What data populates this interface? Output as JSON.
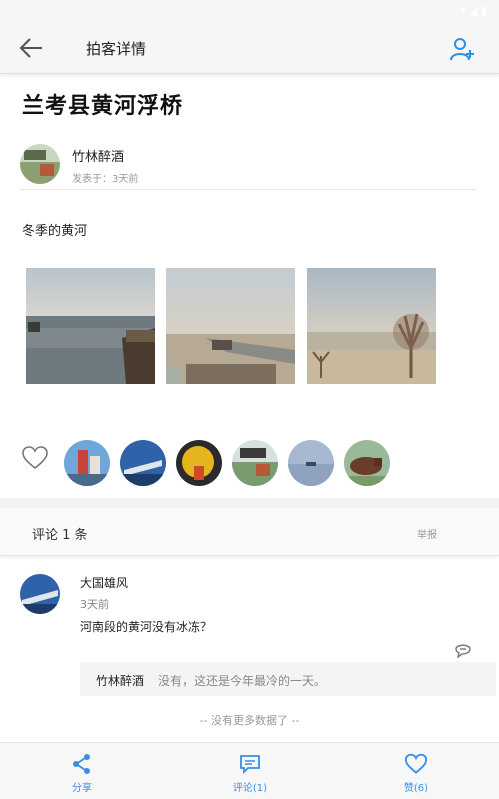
{
  "header": {
    "title": "拍客详情",
    "back_icon": "arrow-left-icon",
    "action_icon": "add-user-icon",
    "accent_color": "#2f8fe8"
  },
  "post": {
    "title": "兰考县黄河浮桥",
    "author": {
      "name": "竹林醉酒",
      "time": "发表于：3天前"
    },
    "text": "冬季的黄河",
    "photos": [
      {
        "name": "photo-river-boat"
      },
      {
        "name": "photo-pontoon-bridge"
      },
      {
        "name": "photo-riverbank-trees"
      }
    ]
  },
  "likes": {
    "heart_icon": "heart-outline-icon",
    "avatar_count": 6
  },
  "comments": {
    "header": "评论 1 条",
    "report": "举报",
    "items": [
      {
        "name": "大国雄风",
        "time": "3天前",
        "text": "河南段的黄河没有冰冻？",
        "reply": {
          "name": "竹林醉酒",
          "text": "没有，这还是今年最冷的一天。"
        }
      }
    ],
    "no_more": "-- 没有更多数据了 --"
  },
  "bottom_bar": {
    "share": "分享",
    "comment": "评论(1)",
    "like": "赞(6)"
  }
}
